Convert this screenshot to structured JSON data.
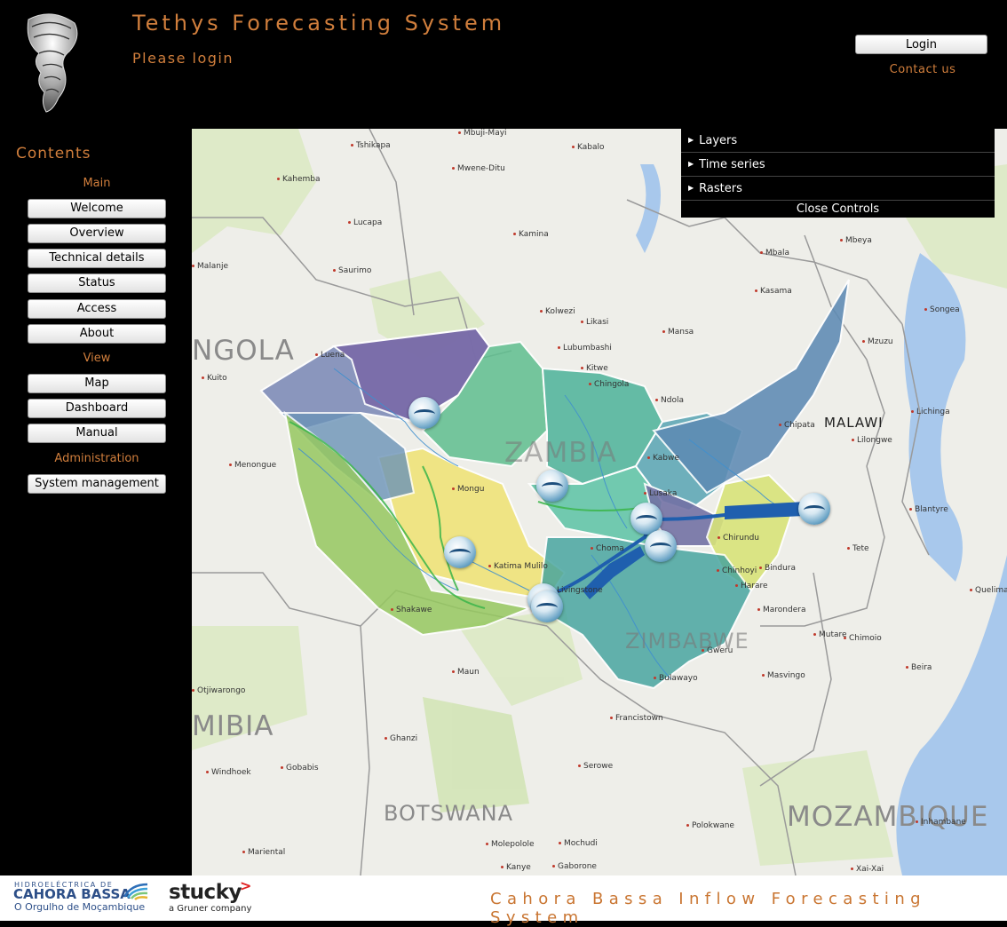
{
  "header": {
    "title": "Tethys Forecasting System",
    "subtitle": "Please login",
    "login_label": "Login",
    "contact_label": "Contact us",
    "logo_icon": "shell-logo-icon"
  },
  "sidebar": {
    "title": "Contents",
    "sections": [
      {
        "heading": "Main",
        "items": [
          "Welcome",
          "Overview",
          "Technical details",
          "Status",
          "Access",
          "About"
        ]
      },
      {
        "heading": "View",
        "items": [
          "Map",
          "Dashboard",
          "Manual"
        ]
      },
      {
        "heading": "Administration",
        "items": [
          "System management"
        ]
      }
    ]
  },
  "map_controls": {
    "items": [
      "Layers",
      "Time series",
      "Rasters"
    ],
    "close_label": "Close Controls"
  },
  "map": {
    "countries": [
      "NGOLA",
      "ZAMBIA",
      "MALAWI",
      "ZIMBABWE",
      "MIBIA",
      "BOTSWANA",
      "MOZAMBIQUE"
    ],
    "cities": [
      "Mbuji-Mayi",
      "Tshikapa",
      "Kabalo",
      "Mwene-Ditu",
      "Kahemba",
      "Lucapa",
      "Kamina",
      "Mbeya",
      "Mbala",
      "Saurimo",
      "Kasama",
      "Songea",
      "Kolwezi",
      "Likasi",
      "Mansa",
      "Mzuzu",
      "Lubumbashi",
      "Chingola",
      "Kitwe",
      "Ndola",
      "Luena",
      "Kuito",
      "Chipata",
      "Lichinga",
      "Lilongwe",
      "Kabwe",
      "Menongue",
      "Mongu",
      "Lusaka",
      "Blantyre",
      "Tete",
      "Chinhoyi",
      "Bindura",
      "Harare",
      "Chirundu",
      "Quelimane",
      "Katima Mulilo",
      "Livingstone",
      "Shakawe",
      "Marondera",
      "Mutare",
      "Chimoio",
      "Gweru",
      "Maun",
      "Beira",
      "Bulawayo",
      "Masvingo",
      "Otjiwarongo",
      "Francistown",
      "Ghanzi",
      "Windhoek",
      "Gobabis",
      "Serowe",
      "Polokwane",
      "Inhambane",
      "Molepolole",
      "Mochudi",
      "Mariental",
      "Kanye",
      "Gaborone",
      "Xai-Xai",
      "Malanje",
      "Choma"
    ],
    "station_count": 8
  },
  "footer": {
    "hcb_top": "HIDROELÉCTRICA DE",
    "hcb_name": "CAHORA BASSA",
    "hcb_tagline": "O Orgulho de Moçambique",
    "stucky_name": "stucky",
    "stucky_sub": "a Gruner company",
    "system_title": "Cahora Bassa Inflow Forecasting System"
  },
  "colors": {
    "accent": "#d07e3c",
    "background": "#000000",
    "map_land": "#eeeee9",
    "water": "#a8c8ec",
    "brand_blue": "#2d4f88",
    "stucky_red": "#e02020"
  }
}
